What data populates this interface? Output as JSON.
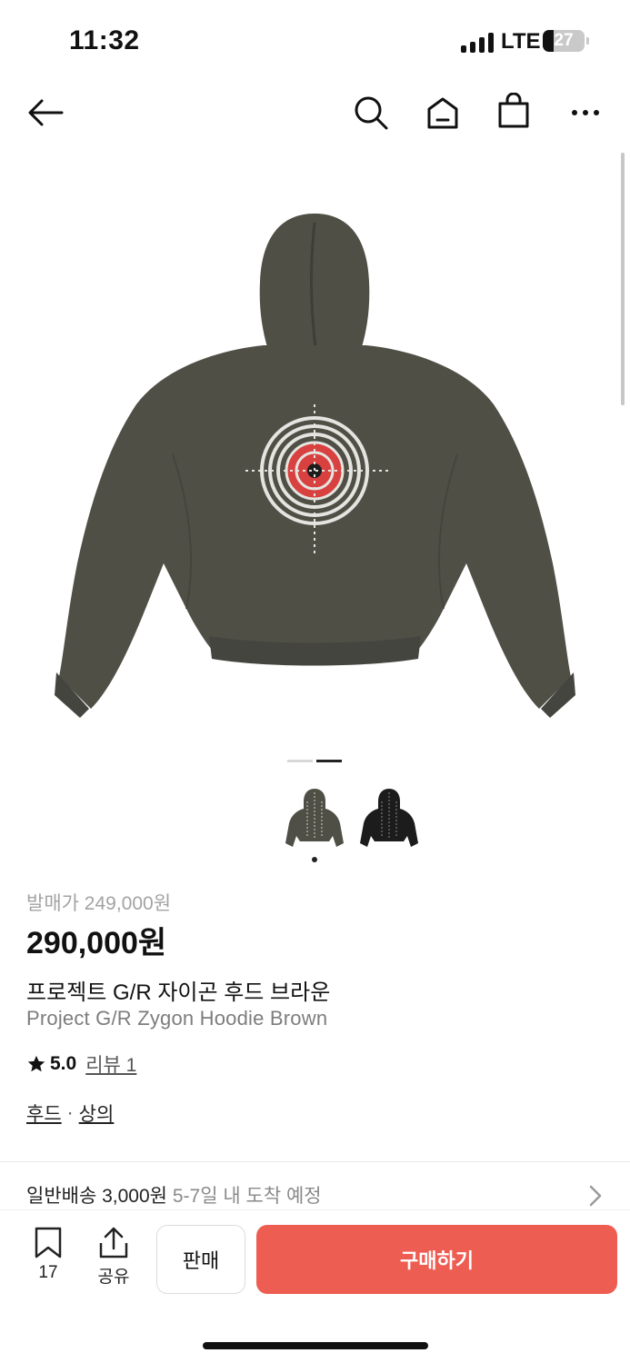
{
  "status_bar": {
    "time": "11:32",
    "network": "LTE",
    "battery": "27"
  },
  "nav": {
    "icons": [
      "back-arrow-icon",
      "search-icon",
      "home-icon",
      "shopping-bag-icon",
      "more-icon"
    ]
  },
  "product": {
    "release_price_label": "발매가 249,000원",
    "price": "290,000원",
    "name_ko": "프로젝트 G/R 자이곤 후드 브라운",
    "name_en": "Project G/R Zygon Hoodie Brown",
    "rating": "5.0",
    "review_label": "리뷰 1",
    "categories": [
      "후드",
      "상의"
    ],
    "category_separator": "·",
    "image_count": 2,
    "active_image_index": 1,
    "thumbnail_colors": [
      "brown",
      "black"
    ]
  },
  "shipping": {
    "main": "일반배송 3,000원",
    "sub": "5-7일 내 도착 예정"
  },
  "bottom_bar": {
    "bookmark_count": "17",
    "share_label": "공유",
    "sell_label": "판매",
    "buy_label": "구매하기"
  },
  "colors": {
    "buy": "#ee5d52",
    "hoodie_brown": "#4f4f46",
    "hoodie_black": "#1c1c1c",
    "target_red": "#d8413f"
  }
}
